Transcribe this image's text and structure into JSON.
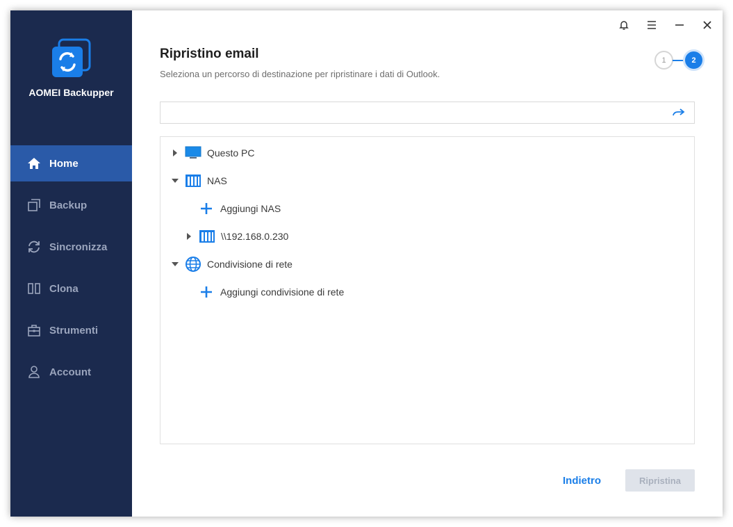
{
  "app": {
    "name": "AOMEI Backupper"
  },
  "sidebar": {
    "items": [
      {
        "label": "Home",
        "icon": "home-icon",
        "active": true
      },
      {
        "label": "Backup",
        "icon": "backup-icon",
        "active": false
      },
      {
        "label": "Sincronizza",
        "icon": "sync-icon",
        "active": false
      },
      {
        "label": "Clona",
        "icon": "clone-icon",
        "active": false
      },
      {
        "label": "Strumenti",
        "icon": "tools-icon",
        "active": false
      },
      {
        "label": "Account",
        "icon": "user-icon",
        "active": false
      }
    ]
  },
  "titlebar": {
    "icons": [
      "bell-icon",
      "menu-icon",
      "minimize-icon",
      "close-icon"
    ]
  },
  "page": {
    "title": "Ripristino email",
    "subtitle": "Seleziona un percorso di destinazione per ripristinare i dati di Outlook."
  },
  "steps": {
    "step1": "1",
    "step2": "2",
    "current": 2
  },
  "path_input": {
    "value": "",
    "placeholder": ""
  },
  "tree": {
    "questo_pc": "Questo PC",
    "nas": "NAS",
    "aggiungi_nas": "Aggiungi NAS",
    "nas_device": "\\\\192.168.0.230",
    "condivisione": "Condivisione di rete",
    "aggiungi_condivisione": "Aggiungi condivisione di rete"
  },
  "footer": {
    "back_label": "Indietro",
    "restore_label": "Ripristina"
  },
  "colors": {
    "sidebar_bg": "#1b2a4e",
    "sidebar_active": "#2a5aa8",
    "accent": "#1a7ee8",
    "disabled_btn": "#dfe3ea"
  }
}
